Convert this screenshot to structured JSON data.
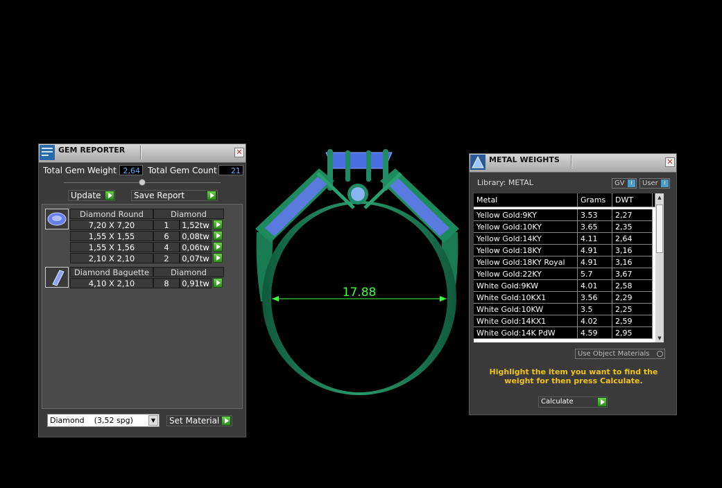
{
  "gem_reporter": {
    "title": "GEM REPORTER",
    "total_weight_label": "Total Gem Weight",
    "total_weight_value": "2,64",
    "total_count_label": "Total Gem Count",
    "total_count_value": "21",
    "update_label": "Update",
    "save_report_label": "Save Report",
    "groups": [
      {
        "cut": "Diamond Round",
        "material": "Diamond",
        "rows": [
          {
            "size": "7,20 X 7,20",
            "qty": "1",
            "weight": "1,52tw"
          },
          {
            "size": "1,55 X 1,55",
            "qty": "6",
            "weight": "0,08tw"
          },
          {
            "size": "1,55 X 1,56",
            "qty": "4",
            "weight": "0,06tw"
          },
          {
            "size": "2,10 X 2,10",
            "qty": "2",
            "weight": "0,07tw"
          }
        ]
      },
      {
        "cut": "Diamond Baguette",
        "material": "Diamond",
        "rows": [
          {
            "size": "4,10 X 2,10",
            "qty": "8",
            "weight": "0,91tw"
          }
        ]
      }
    ],
    "material_select": "Diamond",
    "material_spg": "(3,52 spg)",
    "set_material_label": "Set Material"
  },
  "viewport": {
    "dimension_label": "17.88",
    "colors": {
      "ring": "#1f8a63",
      "gem": "#4a6ee0",
      "measure": "#3cff3c"
    }
  },
  "metal_weights": {
    "title": "METAL WEIGHTS",
    "library_label": "Library: METAL",
    "gv_label": "GV",
    "user_label": "User",
    "columns": [
      "Metal",
      "Grams",
      "DWT"
    ],
    "rows": [
      {
        "metal": "Yellow Gold:9KY",
        "grams": "3.53",
        "dwt": "2,27"
      },
      {
        "metal": "Yellow Gold:10KY",
        "grams": "3.65",
        "dwt": "2,35"
      },
      {
        "metal": "Yellow Gold:14KY",
        "grams": "4.11",
        "dwt": "2,64"
      },
      {
        "metal": "Yellow Gold:18KY",
        "grams": "4.91",
        "dwt": "3,16"
      },
      {
        "metal": "Yellow Gold:18KY Royal",
        "grams": "4.91",
        "dwt": "3,16"
      },
      {
        "metal": "Yellow Gold:22KY",
        "grams": "5.7",
        "dwt": "3,67"
      },
      {
        "metal": "White Gold:9KW",
        "grams": "4.01",
        "dwt": "2,58"
      },
      {
        "metal": "White Gold:10KX1",
        "grams": "3.56",
        "dwt": "2,29"
      },
      {
        "metal": "White Gold:10KW",
        "grams": "3.5",
        "dwt": "2,25"
      },
      {
        "metal": "White Gold:14KX1",
        "grams": "4.02",
        "dwt": "2,59"
      },
      {
        "metal": "White Gold:14K PdW",
        "grams": "4.59",
        "dwt": "2,95"
      }
    ],
    "use_object_materials_label": "Use Object Materials",
    "hint": "Highlight the item you want to find the weight for then press Calculate.",
    "calculate_label": "Calculate",
    "colors": {
      "hint": "#f0c419"
    }
  }
}
